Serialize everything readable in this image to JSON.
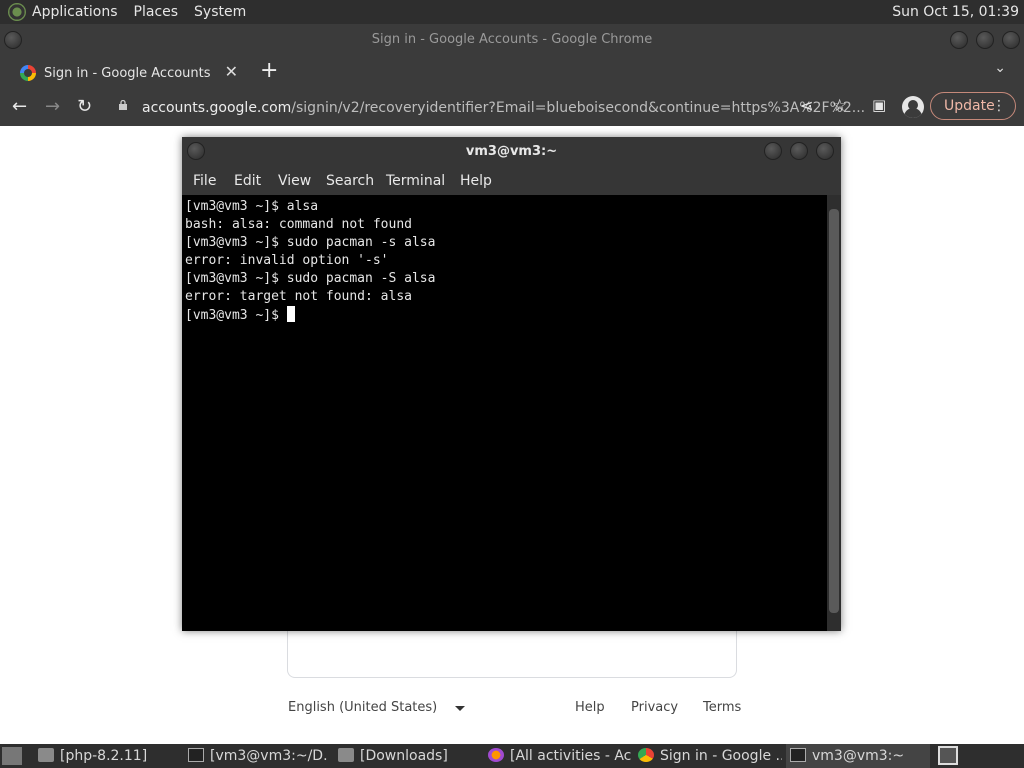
{
  "top_panel": {
    "menus": [
      "Applications",
      "Places",
      "System"
    ],
    "clock": "Sun Oct 15, 01:39"
  },
  "chrome": {
    "window_title": "Sign in - Google Accounts - Google Chrome",
    "tab_title": "Sign in - Google Accounts",
    "url_host": "accounts.google.com",
    "url_path": "/signin/v2/recoveryidentifier?Email=blueboisecond&continue=https%3A%2F%2...",
    "update_label": "Update"
  },
  "google_page": {
    "language": "English (United States)",
    "footer_links": [
      "Help",
      "Privacy",
      "Terms"
    ]
  },
  "terminal": {
    "title": "vm3@vm3:~",
    "menus": [
      "File",
      "Edit",
      "View",
      "Search",
      "Terminal",
      "Help"
    ],
    "lines": [
      "[vm3@vm3 ~]$ alsa",
      "bash: alsa: command not found",
      "[vm3@vm3 ~]$ sudo pacman -s alsa",
      "error: invalid option '-s'",
      "[vm3@vm3 ~]$ sudo pacman -S alsa",
      "error: target not found: alsa",
      "[vm3@vm3 ~]$ "
    ]
  },
  "taskbar": {
    "items": [
      "[php-8.2.11]",
      "[vm3@vm3:~/D...",
      "[Downloads]",
      "[All activities - Ac...",
      "Sign in - Google ...",
      "vm3@vm3:~"
    ]
  }
}
